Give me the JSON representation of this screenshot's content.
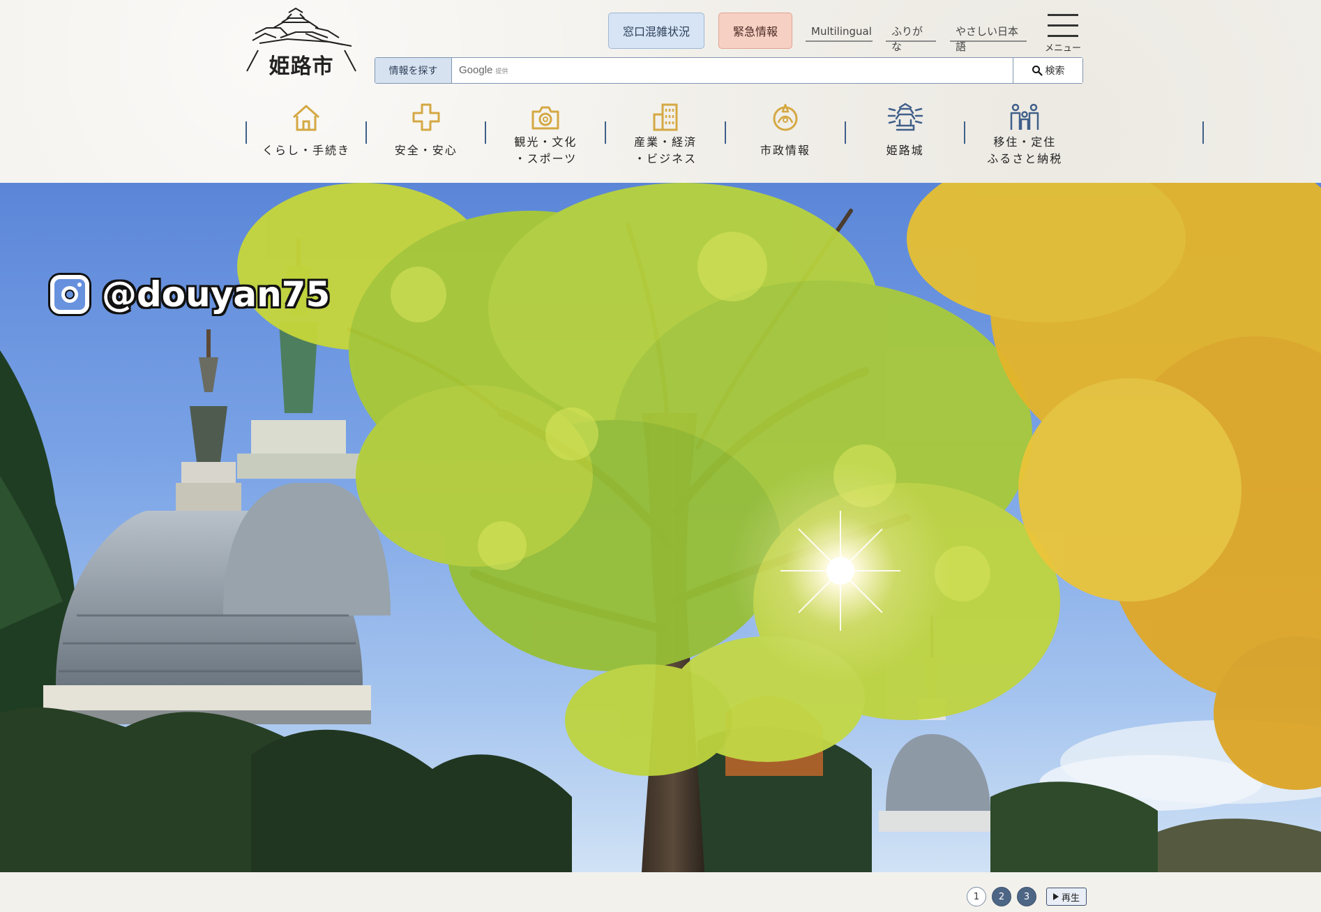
{
  "header": {
    "logo_text": "姫路市",
    "congestion_button": "窓口混雑状況",
    "emergency_button": "緊急情報",
    "links": {
      "multilingual": "Multilingual",
      "furigana": "ふりがな",
      "easy_japanese": "やさしい日本語"
    },
    "menu_label": "メニュー"
  },
  "search": {
    "tag": "情報を探す",
    "google_label": "Google",
    "google_sub": "提供",
    "button_label": "検索"
  },
  "nav": {
    "items": [
      {
        "line1": "くらし・手続き",
        "line2": "",
        "icon": "house-icon"
      },
      {
        "line1": "安全・安心",
        "line2": "",
        "icon": "cross-icon"
      },
      {
        "line1": "観光・文化",
        "line2": "・スポーツ",
        "icon": "camera-icon"
      },
      {
        "line1": "産業・経済",
        "line2": "・ビジネス",
        "icon": "building-icon"
      },
      {
        "line1": "市政情報",
        "line2": "",
        "icon": "city-emblem-icon"
      },
      {
        "line1": "姫路城",
        "line2": "",
        "icon": "castle-icon"
      },
      {
        "line1": "移住・定住",
        "line2": "ふるさと納税",
        "icon": "family-icon"
      }
    ]
  },
  "hero": {
    "instagram_handle": "@douyan75"
  },
  "carousel": {
    "pages": [
      "1",
      "2",
      "3"
    ],
    "active_page": "1",
    "play_label": "再生"
  },
  "colors": {
    "nav_divider": "#3f5f8a",
    "nav_icon_gold": "#d4a843",
    "nav_icon_blue": "#3f5f8a",
    "congestion_bg": "#d6e4f5",
    "emergency_bg": "#f7d0c4",
    "pager_inactive": "#4e6685"
  }
}
